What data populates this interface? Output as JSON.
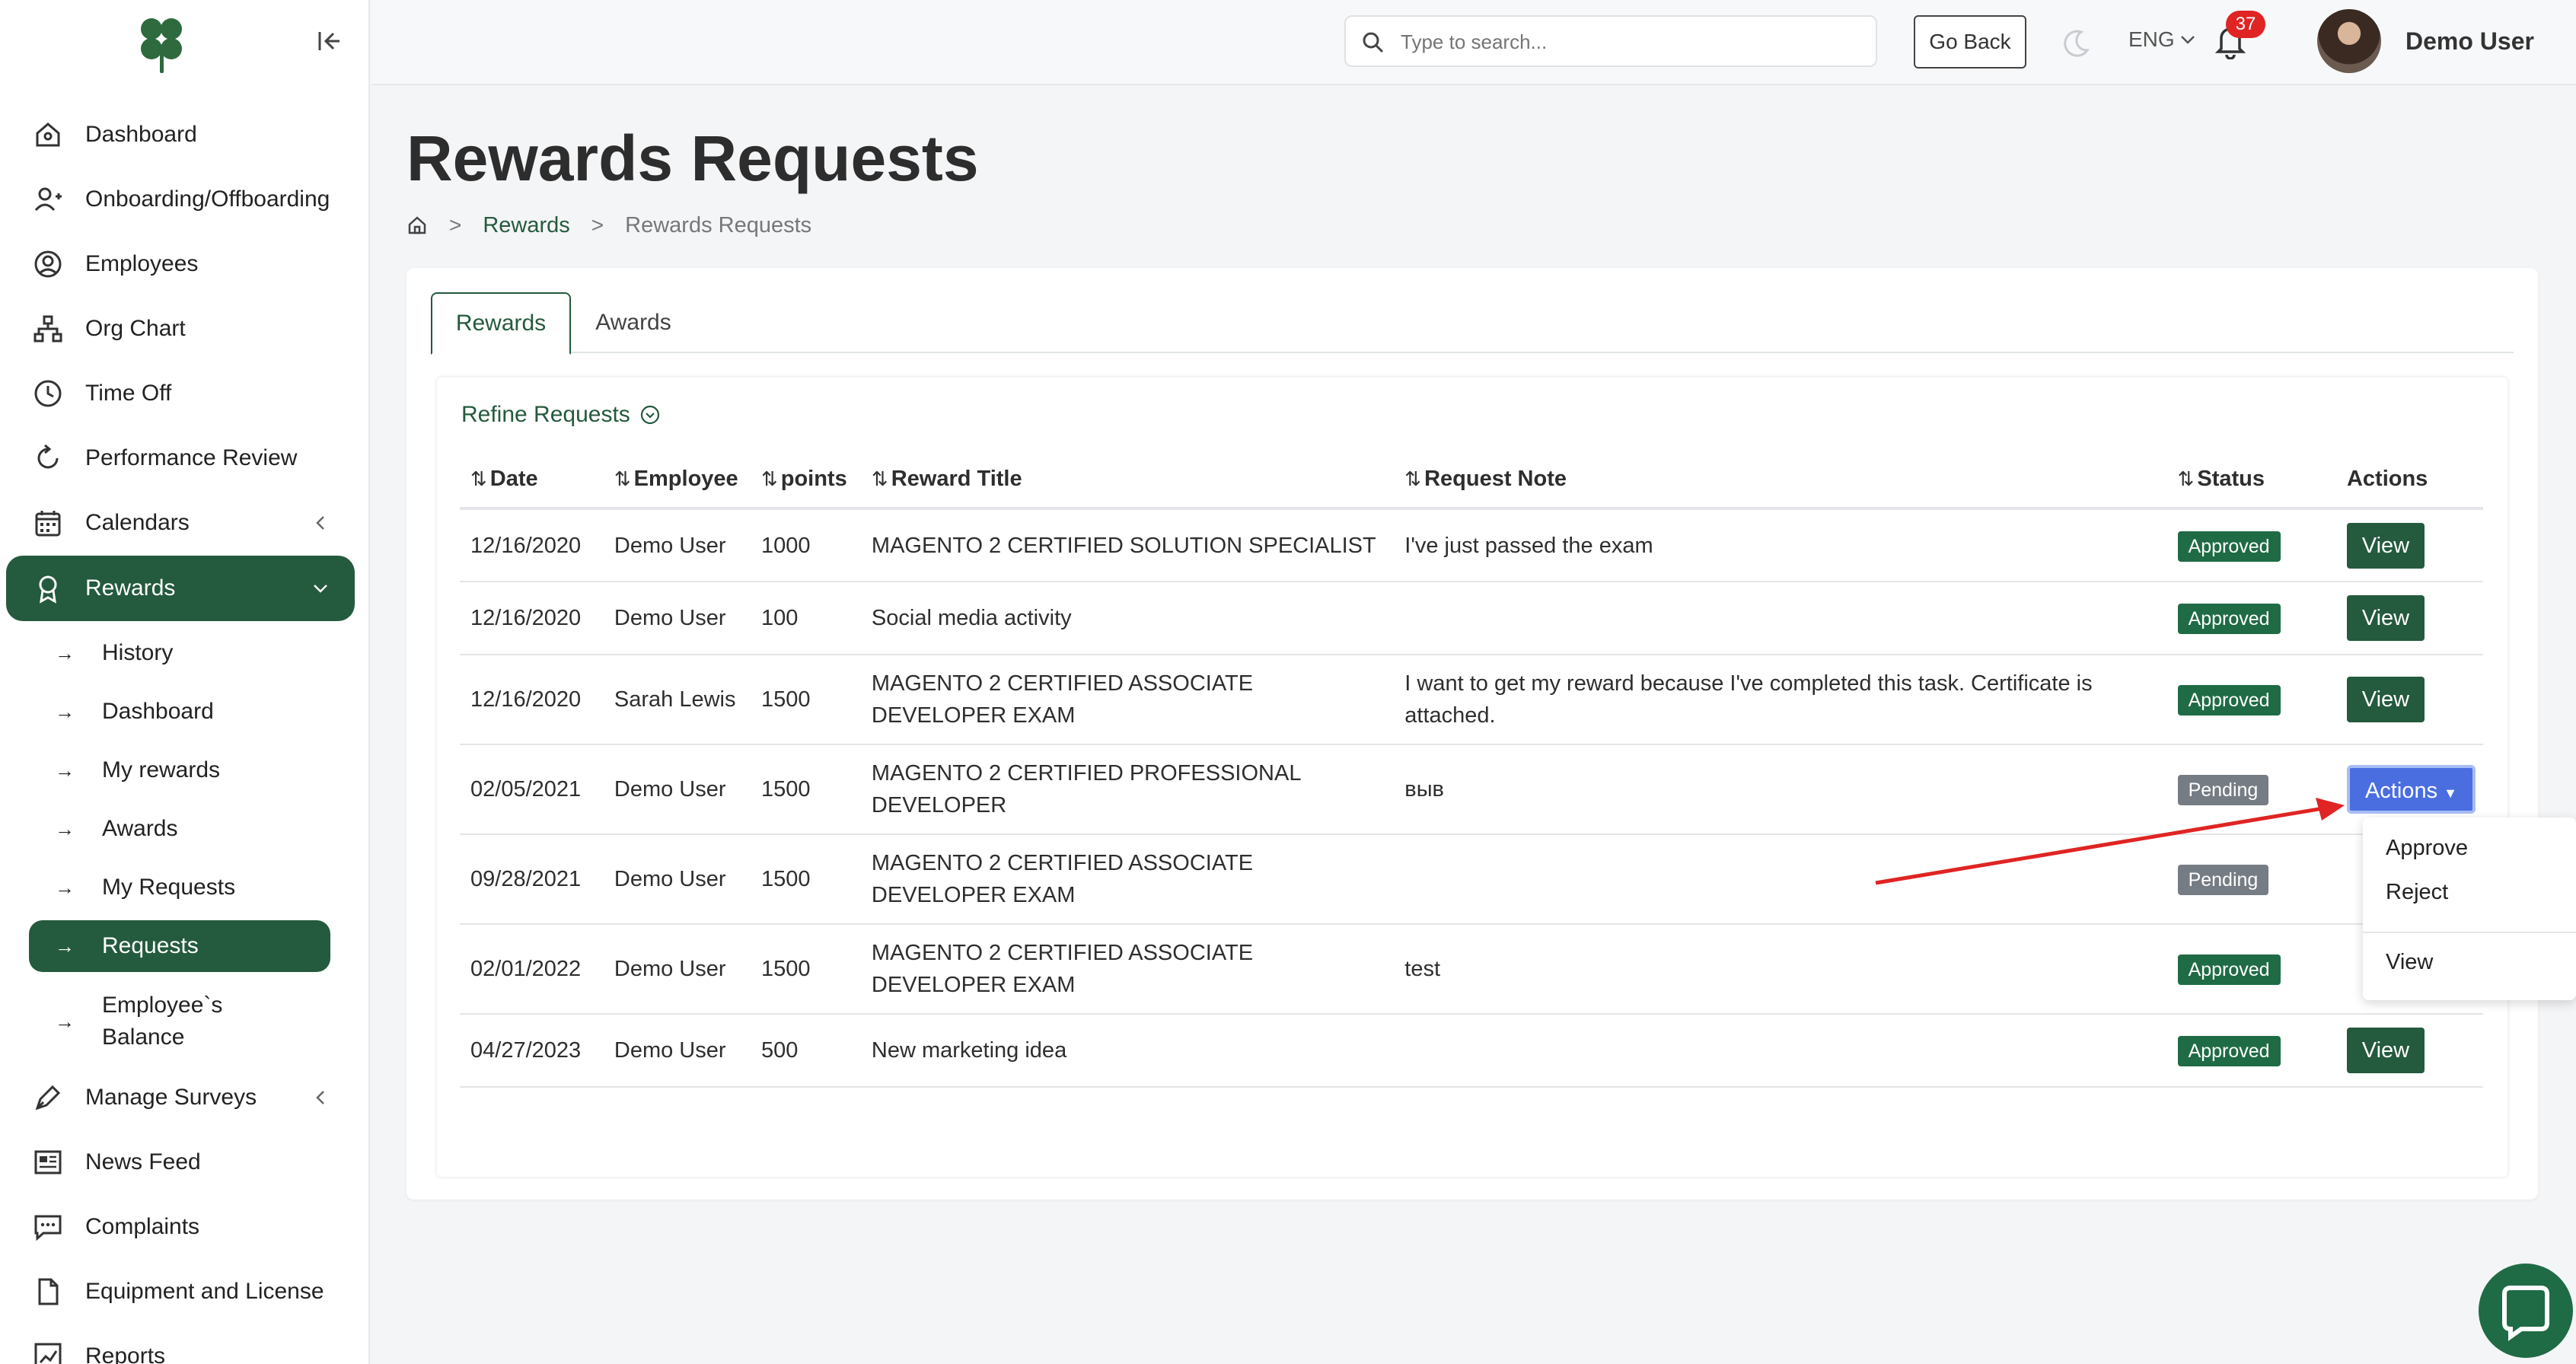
{
  "sidebar": {
    "items": [
      {
        "label": "Dashboard",
        "icon": "home-icon"
      },
      {
        "label": "Onboarding/Offboarding",
        "icon": "user-plus-icon"
      },
      {
        "label": "Employees",
        "icon": "user-circle-icon"
      },
      {
        "label": "Org Chart",
        "icon": "org-chart-icon"
      },
      {
        "label": "Time Off",
        "icon": "clock-icon"
      },
      {
        "label": "Performance Review",
        "icon": "refresh-icon"
      },
      {
        "label": "Calendars",
        "icon": "calendar-icon"
      },
      {
        "label": "Rewards",
        "icon": "award-icon"
      },
      {
        "label": "Manage Surveys",
        "icon": "pen-icon"
      },
      {
        "label": "News Feed",
        "icon": "newspaper-icon"
      },
      {
        "label": "Complaints",
        "icon": "chat-dots-icon"
      },
      {
        "label": "Equipment and License",
        "icon": "document-icon"
      },
      {
        "label": "Reports",
        "icon": "chart-line-icon"
      }
    ],
    "rewards_submenu": [
      {
        "label": "History"
      },
      {
        "label": "Dashboard"
      },
      {
        "label": "My rewards"
      },
      {
        "label": "Awards"
      },
      {
        "label": "My Requests"
      },
      {
        "label": "Requests"
      },
      {
        "label": "Employee`s",
        "label2": "Balance"
      }
    ]
  },
  "topbar": {
    "search_placeholder": "Type to search...",
    "go_back": "Go Back",
    "language": "ENG",
    "notifications_count": "37",
    "user_name": "Demo User"
  },
  "page": {
    "title": "Rewards Requests",
    "breadcrumb": [
      "Rewards",
      "Rewards Requests"
    ]
  },
  "tabs": [
    {
      "label": "Rewards",
      "active": true
    },
    {
      "label": "Awards",
      "active": false
    }
  ],
  "refine_label": "Refine Requests",
  "table": {
    "columns": [
      "Date",
      "Employee",
      "points",
      "Reward Title",
      "Request Note",
      "Status",
      "Actions"
    ],
    "rows": [
      {
        "date": "12/16/2020",
        "employee": "Demo User",
        "points": "1000",
        "title": "MAGENTO 2 CERTIFIED SOLUTION SPECIALIST",
        "note": "I've just passed the exam",
        "status": "Approved",
        "action": "View"
      },
      {
        "date": "12/16/2020",
        "employee": "Demo User",
        "points": "100",
        "title": "Social media activity",
        "note": "",
        "status": "Approved",
        "action": "View"
      },
      {
        "date": "12/16/2020",
        "employee": "Sarah Lewis",
        "points": "1500",
        "title": "MAGENTO 2 CERTIFIED ASSOCIATE DEVELOPER EXAM",
        "note": "I want to get my reward because I've completed this task. Certificate is attached.",
        "status": "Approved",
        "action": "View"
      },
      {
        "date": "02/05/2021",
        "employee": "Demo User",
        "points": "1500",
        "title": "MAGENTO 2 CERTIFIED PROFESSIONAL DEVELOPER",
        "note": "выв",
        "status": "Pending",
        "action": "Actions"
      },
      {
        "date": "09/28/2021",
        "employee": "Demo User",
        "points": "1500",
        "title": "MAGENTO 2 CERTIFIED ASSOCIATE DEVELOPER EXAM",
        "note": "",
        "status": "Pending",
        "action": ""
      },
      {
        "date": "02/01/2022",
        "employee": "Demo User",
        "points": "1500",
        "title": "MAGENTO 2 CERTIFIED ASSOCIATE DEVELOPER EXAM",
        "note": "test",
        "status": "Approved",
        "action": ""
      },
      {
        "date": "04/27/2023",
        "employee": "Demo User",
        "points": "500",
        "title": "New marketing idea",
        "note": "",
        "status": "Approved",
        "action": "View"
      }
    ]
  },
  "dropdown": {
    "items": [
      "Approve",
      "Reject",
      "View"
    ]
  },
  "colors": {
    "brand_green": "#245a3d",
    "approved": "#1f6b45",
    "pending": "#767c83",
    "actions_blue": "#4a6ee0",
    "annotation_red": "#e02424"
  }
}
